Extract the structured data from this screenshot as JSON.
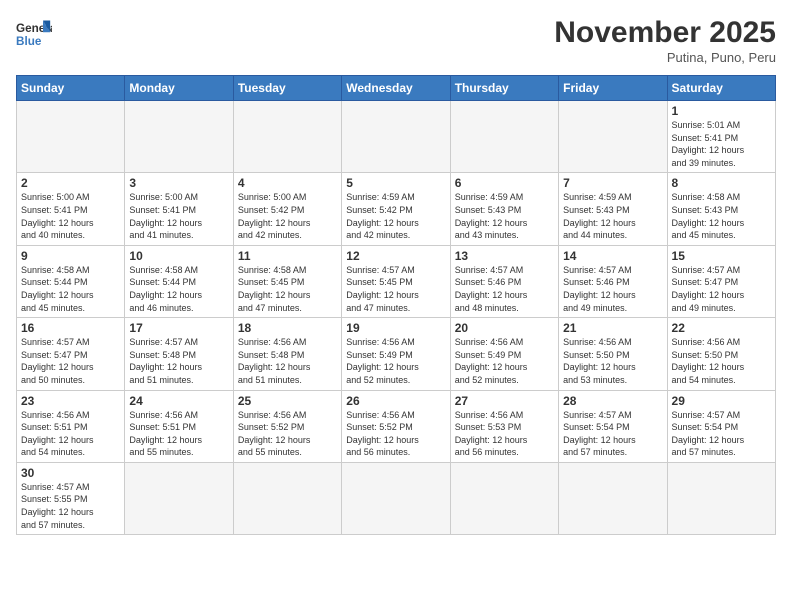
{
  "header": {
    "logo_general": "General",
    "logo_blue": "Blue",
    "month_title": "November 2025",
    "location": "Putina, Puno, Peru"
  },
  "weekdays": [
    "Sunday",
    "Monday",
    "Tuesday",
    "Wednesday",
    "Thursday",
    "Friday",
    "Saturday"
  ],
  "weeks": [
    [
      {
        "day": "",
        "info": ""
      },
      {
        "day": "",
        "info": ""
      },
      {
        "day": "",
        "info": ""
      },
      {
        "day": "",
        "info": ""
      },
      {
        "day": "",
        "info": ""
      },
      {
        "day": "",
        "info": ""
      },
      {
        "day": "1",
        "info": "Sunrise: 5:01 AM\nSunset: 5:41 PM\nDaylight: 12 hours\nand 39 minutes."
      }
    ],
    [
      {
        "day": "2",
        "info": "Sunrise: 5:00 AM\nSunset: 5:41 PM\nDaylight: 12 hours\nand 40 minutes."
      },
      {
        "day": "3",
        "info": "Sunrise: 5:00 AM\nSunset: 5:41 PM\nDaylight: 12 hours\nand 41 minutes."
      },
      {
        "day": "4",
        "info": "Sunrise: 5:00 AM\nSunset: 5:42 PM\nDaylight: 12 hours\nand 42 minutes."
      },
      {
        "day": "5",
        "info": "Sunrise: 4:59 AM\nSunset: 5:42 PM\nDaylight: 12 hours\nand 42 minutes."
      },
      {
        "day": "6",
        "info": "Sunrise: 4:59 AM\nSunset: 5:43 PM\nDaylight: 12 hours\nand 43 minutes."
      },
      {
        "day": "7",
        "info": "Sunrise: 4:59 AM\nSunset: 5:43 PM\nDaylight: 12 hours\nand 44 minutes."
      },
      {
        "day": "8",
        "info": "Sunrise: 4:58 AM\nSunset: 5:43 PM\nDaylight: 12 hours\nand 45 minutes."
      }
    ],
    [
      {
        "day": "9",
        "info": "Sunrise: 4:58 AM\nSunset: 5:44 PM\nDaylight: 12 hours\nand 45 minutes."
      },
      {
        "day": "10",
        "info": "Sunrise: 4:58 AM\nSunset: 5:44 PM\nDaylight: 12 hours\nand 46 minutes."
      },
      {
        "day": "11",
        "info": "Sunrise: 4:58 AM\nSunset: 5:45 PM\nDaylight: 12 hours\nand 47 minutes."
      },
      {
        "day": "12",
        "info": "Sunrise: 4:57 AM\nSunset: 5:45 PM\nDaylight: 12 hours\nand 47 minutes."
      },
      {
        "day": "13",
        "info": "Sunrise: 4:57 AM\nSunset: 5:46 PM\nDaylight: 12 hours\nand 48 minutes."
      },
      {
        "day": "14",
        "info": "Sunrise: 4:57 AM\nSunset: 5:46 PM\nDaylight: 12 hours\nand 49 minutes."
      },
      {
        "day": "15",
        "info": "Sunrise: 4:57 AM\nSunset: 5:47 PM\nDaylight: 12 hours\nand 49 minutes."
      }
    ],
    [
      {
        "day": "16",
        "info": "Sunrise: 4:57 AM\nSunset: 5:47 PM\nDaylight: 12 hours\nand 50 minutes."
      },
      {
        "day": "17",
        "info": "Sunrise: 4:57 AM\nSunset: 5:48 PM\nDaylight: 12 hours\nand 51 minutes."
      },
      {
        "day": "18",
        "info": "Sunrise: 4:56 AM\nSunset: 5:48 PM\nDaylight: 12 hours\nand 51 minutes."
      },
      {
        "day": "19",
        "info": "Sunrise: 4:56 AM\nSunset: 5:49 PM\nDaylight: 12 hours\nand 52 minutes."
      },
      {
        "day": "20",
        "info": "Sunrise: 4:56 AM\nSunset: 5:49 PM\nDaylight: 12 hours\nand 52 minutes."
      },
      {
        "day": "21",
        "info": "Sunrise: 4:56 AM\nSunset: 5:50 PM\nDaylight: 12 hours\nand 53 minutes."
      },
      {
        "day": "22",
        "info": "Sunrise: 4:56 AM\nSunset: 5:50 PM\nDaylight: 12 hours\nand 54 minutes."
      }
    ],
    [
      {
        "day": "23",
        "info": "Sunrise: 4:56 AM\nSunset: 5:51 PM\nDaylight: 12 hours\nand 54 minutes."
      },
      {
        "day": "24",
        "info": "Sunrise: 4:56 AM\nSunset: 5:51 PM\nDaylight: 12 hours\nand 55 minutes."
      },
      {
        "day": "25",
        "info": "Sunrise: 4:56 AM\nSunset: 5:52 PM\nDaylight: 12 hours\nand 55 minutes."
      },
      {
        "day": "26",
        "info": "Sunrise: 4:56 AM\nSunset: 5:52 PM\nDaylight: 12 hours\nand 56 minutes."
      },
      {
        "day": "27",
        "info": "Sunrise: 4:56 AM\nSunset: 5:53 PM\nDaylight: 12 hours\nand 56 minutes."
      },
      {
        "day": "28",
        "info": "Sunrise: 4:57 AM\nSunset: 5:54 PM\nDaylight: 12 hours\nand 57 minutes."
      },
      {
        "day": "29",
        "info": "Sunrise: 4:57 AM\nSunset: 5:54 PM\nDaylight: 12 hours\nand 57 minutes."
      }
    ],
    [
      {
        "day": "30",
        "info": "Sunrise: 4:57 AM\nSunset: 5:55 PM\nDaylight: 12 hours\nand 57 minutes."
      },
      {
        "day": "",
        "info": ""
      },
      {
        "day": "",
        "info": ""
      },
      {
        "day": "",
        "info": ""
      },
      {
        "day": "",
        "info": ""
      },
      {
        "day": "",
        "info": ""
      },
      {
        "day": "",
        "info": ""
      }
    ]
  ]
}
